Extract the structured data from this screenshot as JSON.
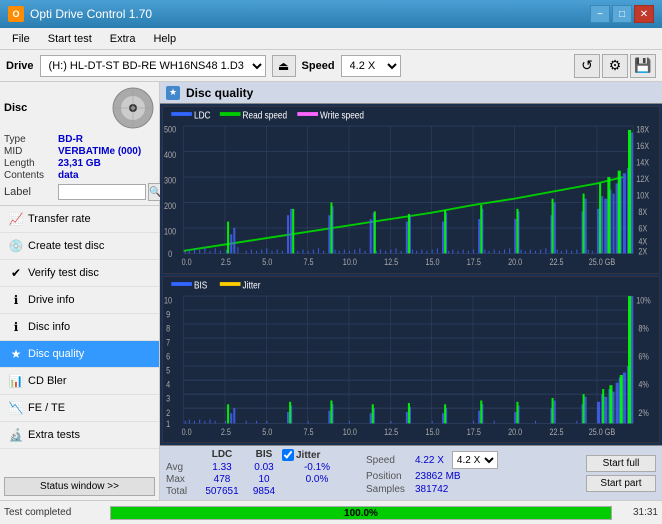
{
  "titlebar": {
    "icon": "O",
    "title": "Opti Drive Control 1.70",
    "min": "−",
    "max": "□",
    "close": "✕"
  },
  "menubar": {
    "items": [
      "File",
      "Start test",
      "Extra",
      "Help"
    ]
  },
  "drivebar": {
    "label": "Drive",
    "drive_value": "(H:)  HL-DT-ST BD-RE  WH16NS48 1.D3",
    "speed_label": "Speed",
    "speed_value": "4.2 X"
  },
  "disc": {
    "title": "Disc",
    "type_label": "Type",
    "type_value": "BD-R",
    "mid_label": "MID",
    "mid_value": "VERBATIMe (000)",
    "length_label": "Length",
    "length_value": "23,31 GB",
    "contents_label": "Contents",
    "contents_value": "data",
    "label_label": "Label"
  },
  "nav": {
    "items": [
      {
        "id": "transfer-rate",
        "label": "Transfer rate",
        "icon": "📈"
      },
      {
        "id": "create-test-disc",
        "label": "Create test disc",
        "icon": "💿"
      },
      {
        "id": "verify-test-disc",
        "label": "Verify test disc",
        "icon": "✔"
      },
      {
        "id": "drive-info",
        "label": "Drive info",
        "icon": "ℹ"
      },
      {
        "id": "disc-info",
        "label": "Disc info",
        "icon": "ℹ"
      },
      {
        "id": "disc-quality",
        "label": "Disc quality",
        "icon": "★",
        "active": true
      },
      {
        "id": "cd-bler",
        "label": "CD Bler",
        "icon": "📊"
      },
      {
        "id": "fe-te",
        "label": "FE / TE",
        "icon": "📉"
      },
      {
        "id": "extra-tests",
        "label": "Extra tests",
        "icon": "🔬"
      }
    ]
  },
  "status_window_btn": "Status window >>",
  "progress": {
    "value": 100,
    "text": "100.0%"
  },
  "time": "31:31",
  "status_text": "Test completed",
  "discquality": {
    "title": "Disc quality"
  },
  "chart1": {
    "legend": [
      {
        "label": "LDC",
        "color": "#3366ff"
      },
      {
        "label": "Read speed",
        "color": "#00cc00"
      },
      {
        "label": "Write speed",
        "color": "#ff66ff"
      }
    ],
    "y_max": 500,
    "y_labels": [
      "500",
      "400",
      "300",
      "200",
      "100",
      "0"
    ],
    "y_right_labels": [
      "18X",
      "16X",
      "14X",
      "12X",
      "10X",
      "8X",
      "6X",
      "4X",
      "2X"
    ],
    "x_labels": [
      "0.0",
      "2.5",
      "5.0",
      "7.5",
      "10.0",
      "12.5",
      "15.0",
      "17.5",
      "20.0",
      "22.5",
      "25.0 GB"
    ]
  },
  "chart2": {
    "legend": [
      {
        "label": "BIS",
        "color": "#3366ff"
      },
      {
        "label": "Jitter",
        "color": "#ffcc00"
      }
    ],
    "y_max": 10,
    "y_labels": [
      "10",
      "9",
      "8",
      "7",
      "6",
      "5",
      "4",
      "3",
      "2",
      "1"
    ],
    "y_right_labels": [
      "10%",
      "8%",
      "6%",
      "4%",
      "2%"
    ],
    "x_labels": [
      "0.0",
      "2.5",
      "5.0",
      "7.5",
      "10.0",
      "12.5",
      "15.0",
      "17.5",
      "20.0",
      "22.5",
      "25.0 GB"
    ]
  },
  "stats": {
    "ldc_label": "LDC",
    "bis_label": "BIS",
    "jitter_label": "Jitter",
    "avg_label": "Avg",
    "ldc_avg": "1.33",
    "bis_avg": "0.03",
    "jitter_avg": "-0.1%",
    "max_label": "Max",
    "ldc_max": "478",
    "bis_max": "10",
    "jitter_max": "0.0%",
    "total_label": "Total",
    "ldc_total": "507651",
    "bis_total": "9854",
    "speed_label": "Speed",
    "speed_value": "4.22 X",
    "speed_select": "4.2 X",
    "position_label": "Position",
    "position_value": "23862 MB",
    "samples_label": "Samples",
    "samples_value": "381742",
    "btn_start_full": "Start full",
    "btn_start_part": "Start part"
  }
}
